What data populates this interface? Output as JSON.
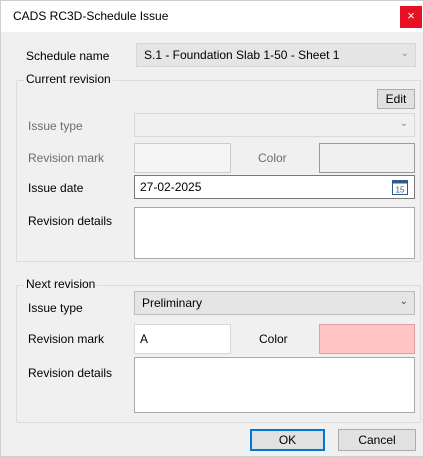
{
  "window": {
    "title": "CADS RC3D-Schedule Issue",
    "close_glyph": "×"
  },
  "schedule": {
    "label": "Schedule name",
    "value": "S.1 - Foundation Slab 1-50 - Sheet 1"
  },
  "current": {
    "group_title": "Current revision",
    "edit_label": "Edit",
    "issue_type_label": "Issue type",
    "issue_type_value": "",
    "revision_mark_label": "Revision mark",
    "revision_mark_value": "",
    "color_label": "Color",
    "color_value": "#f0f0f0",
    "issue_date_label": "Issue date",
    "issue_date_value": "27-02-2025",
    "calendar_day": "15",
    "revision_details_label": "Revision details",
    "revision_details_value": ""
  },
  "next": {
    "group_title": "Next revision",
    "issue_type_label": "Issue type",
    "issue_type_value": "Preliminary",
    "revision_mark_label": "Revision mark",
    "revision_mark_value": "A",
    "color_label": "Color",
    "color_value": "#ffc4c4",
    "revision_details_label": "Revision details",
    "revision_details_value": ""
  },
  "buttons": {
    "ok": "OK",
    "cancel": "Cancel"
  },
  "colors": {
    "accent": "#0078d7",
    "close": "#e81123",
    "window_bg": "#f0f0f0"
  }
}
